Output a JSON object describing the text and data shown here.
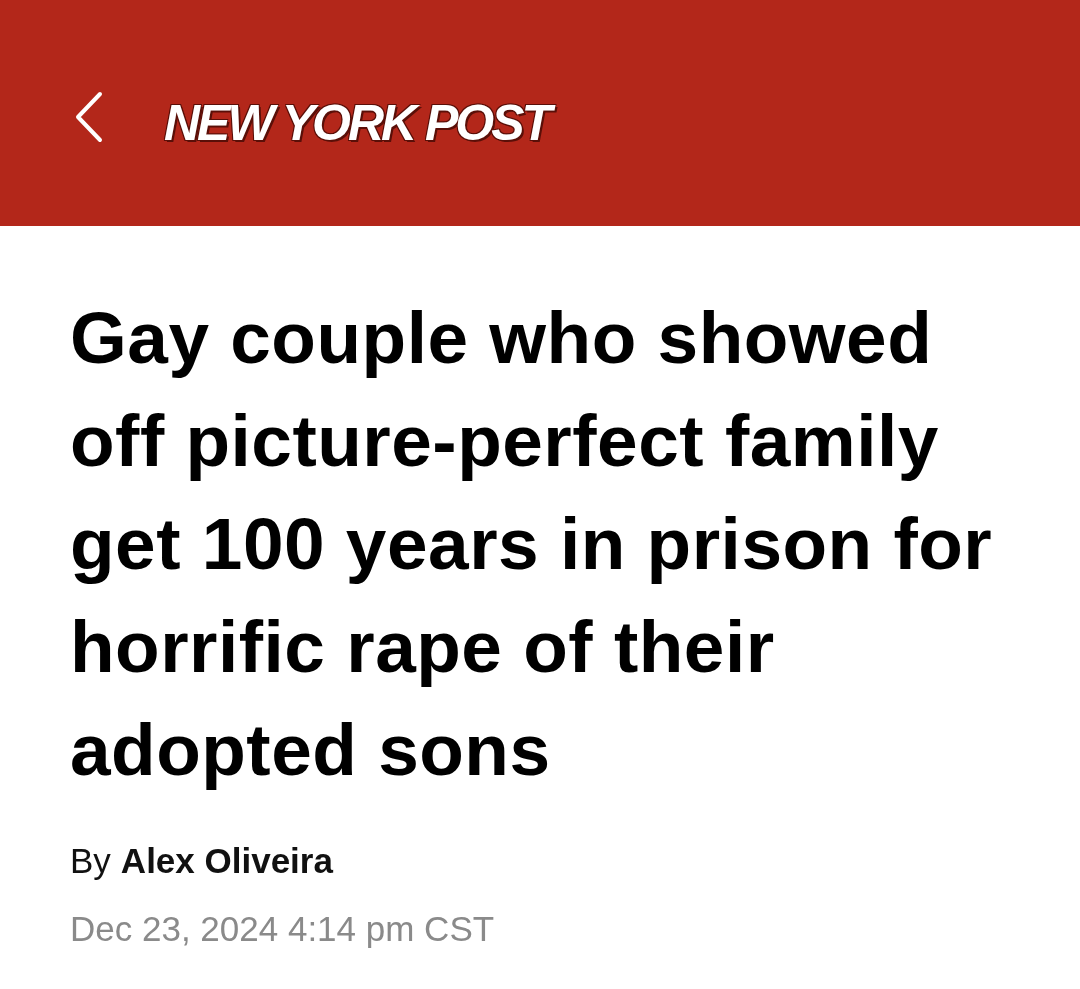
{
  "header": {
    "logo": "NEW YORK POST"
  },
  "article": {
    "headline": "Gay couple who showed off picture-perfect family get 100 years in prison for horrific rape of their adopted sons",
    "byline_prefix": "By",
    "author": "Alex Oliveira",
    "date": "Dec 23, 2024 4:14 pm CST"
  }
}
